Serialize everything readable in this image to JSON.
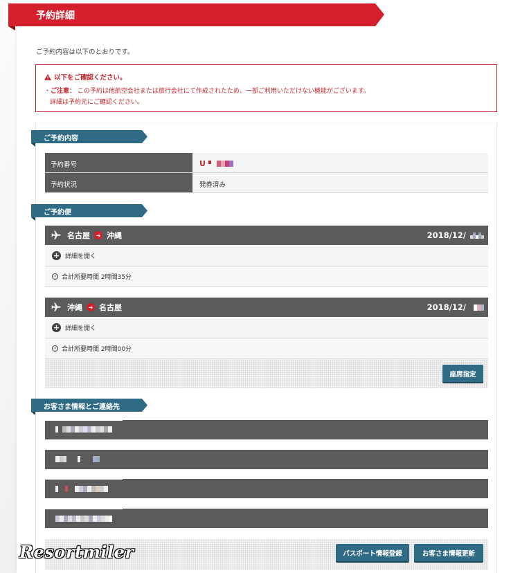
{
  "page_title": "予約詳細",
  "intro": "ご予約内容は以下のとおりです。",
  "notice": {
    "heading": "以下をご確認ください。",
    "caution_label": "ご注意：",
    "caution_text": "この予約は他航空会社または旅行会社にて作成されたため、一部ご利用いただけない機能がございます。",
    "caution_text2": "詳細は予約元にご確認ください。"
  },
  "reservation": {
    "section_title": "ご予約内容",
    "rows": [
      {
        "label": "予約番号",
        "value": "U"
      },
      {
        "label": "予約状況",
        "value": "発券済み"
      }
    ]
  },
  "flights": {
    "section_title": "ご予約便",
    "items": [
      {
        "from": "名古屋",
        "to": "沖縄",
        "date": "2018/12/",
        "details_label": "詳細を開く",
        "duration": "合計所要時間 2時間35分"
      },
      {
        "from": "沖縄",
        "to": "名古屋",
        "date": "2018/12/",
        "details_label": "詳細を開く",
        "duration": "合計所要時間 2時間00分"
      }
    ],
    "seat_button": "座席指定"
  },
  "guest": {
    "section_title": "お客さま情報とご連絡先",
    "passport_button": "パスポート情報登録",
    "update_button": "お客さま情報更新"
  },
  "watermark": "Resortmiler",
  "colors": {
    "brand_red": "#d4202c",
    "section_teal": "#2f6b84",
    "header_gray": "#5b5b5b"
  }
}
